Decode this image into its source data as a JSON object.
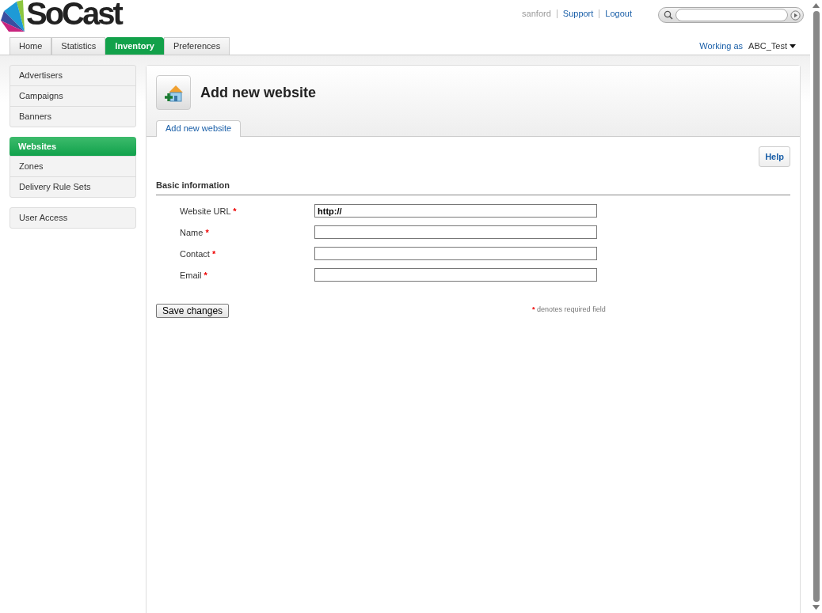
{
  "logo": {
    "text": "SoCast"
  },
  "user_links": [
    {
      "label": "sanford",
      "kind": "user"
    },
    {
      "label": "Support",
      "kind": "link"
    },
    {
      "label": "Logout",
      "kind": "link"
    }
  ],
  "nav_tabs": [
    {
      "label": "Home",
      "selected": false
    },
    {
      "label": "Statistics",
      "selected": false
    },
    {
      "label": "Inventory",
      "selected": true
    },
    {
      "label": "Preferences",
      "selected": false
    }
  ],
  "working_as": {
    "label": "Working as",
    "account": "ABC_Test"
  },
  "sidebar": {
    "groups": [
      {
        "items": [
          {
            "label": "Advertisers",
            "selected": false
          },
          {
            "label": "Campaigns",
            "selected": false
          },
          {
            "label": "Banners",
            "selected": false
          }
        ]
      },
      {
        "items": [
          {
            "label": "Websites",
            "selected": true
          },
          {
            "label": "Zones",
            "selected": false
          },
          {
            "label": "Delivery Rule Sets",
            "selected": false
          }
        ]
      },
      {
        "items": [
          {
            "label": "User Access",
            "selected": false
          }
        ]
      }
    ]
  },
  "page": {
    "title": "Add new website",
    "tabs": [
      {
        "label": "Add new website",
        "selected": true
      }
    ],
    "help_button": "Help",
    "section_title": "Basic information",
    "fields": [
      {
        "label": "Website URL",
        "required_mark": "*",
        "value": "http://"
      },
      {
        "label": "Name",
        "required_mark": "*"
      },
      {
        "label": "Contact",
        "required_mark": "*"
      },
      {
        "label": "Email",
        "required_mark": "*"
      }
    ],
    "save_button": "Save changes",
    "required_note": {
      "mark": "*",
      "text": "denotes required field"
    }
  }
}
